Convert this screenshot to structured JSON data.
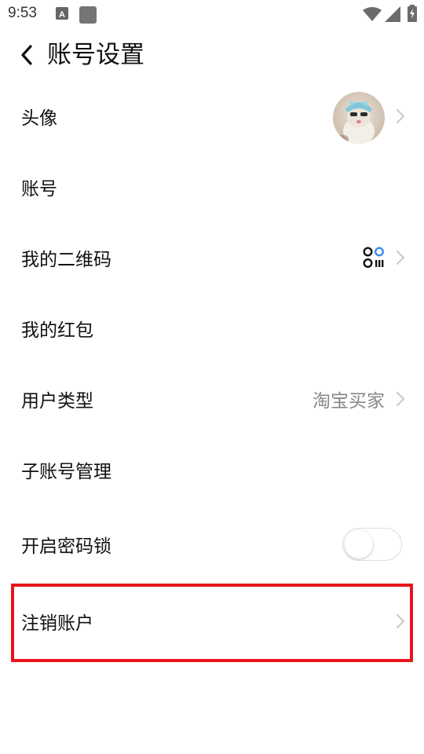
{
  "status_bar": {
    "time": "9:53",
    "icons": [
      "a-notification-icon",
      "square-notification-icon",
      "wifi-icon",
      "signal-icon",
      "battery-charging-icon"
    ]
  },
  "header": {
    "back_icon": "chevron-left-icon",
    "title": "账号设置"
  },
  "settings": {
    "avatar": {
      "label": "头像"
    },
    "account": {
      "label": "账号"
    },
    "qr_code": {
      "label": "我的二维码",
      "icon": "qr-code-icon"
    },
    "red_packet": {
      "label": "我的红包"
    },
    "user_type": {
      "label": "用户类型",
      "value": "淘宝买家"
    },
    "sub_account": {
      "label": "子账号管理"
    },
    "password_lock": {
      "label": "开启密码锁",
      "enabled": false
    },
    "cancel_account": {
      "label": "注销账户"
    }
  },
  "colors": {
    "highlight": "#e8141c",
    "text_primary": "#111111",
    "text_secondary": "#888888",
    "chevron": "#c8c8c8",
    "qr_accent": "#3a8ee6"
  }
}
